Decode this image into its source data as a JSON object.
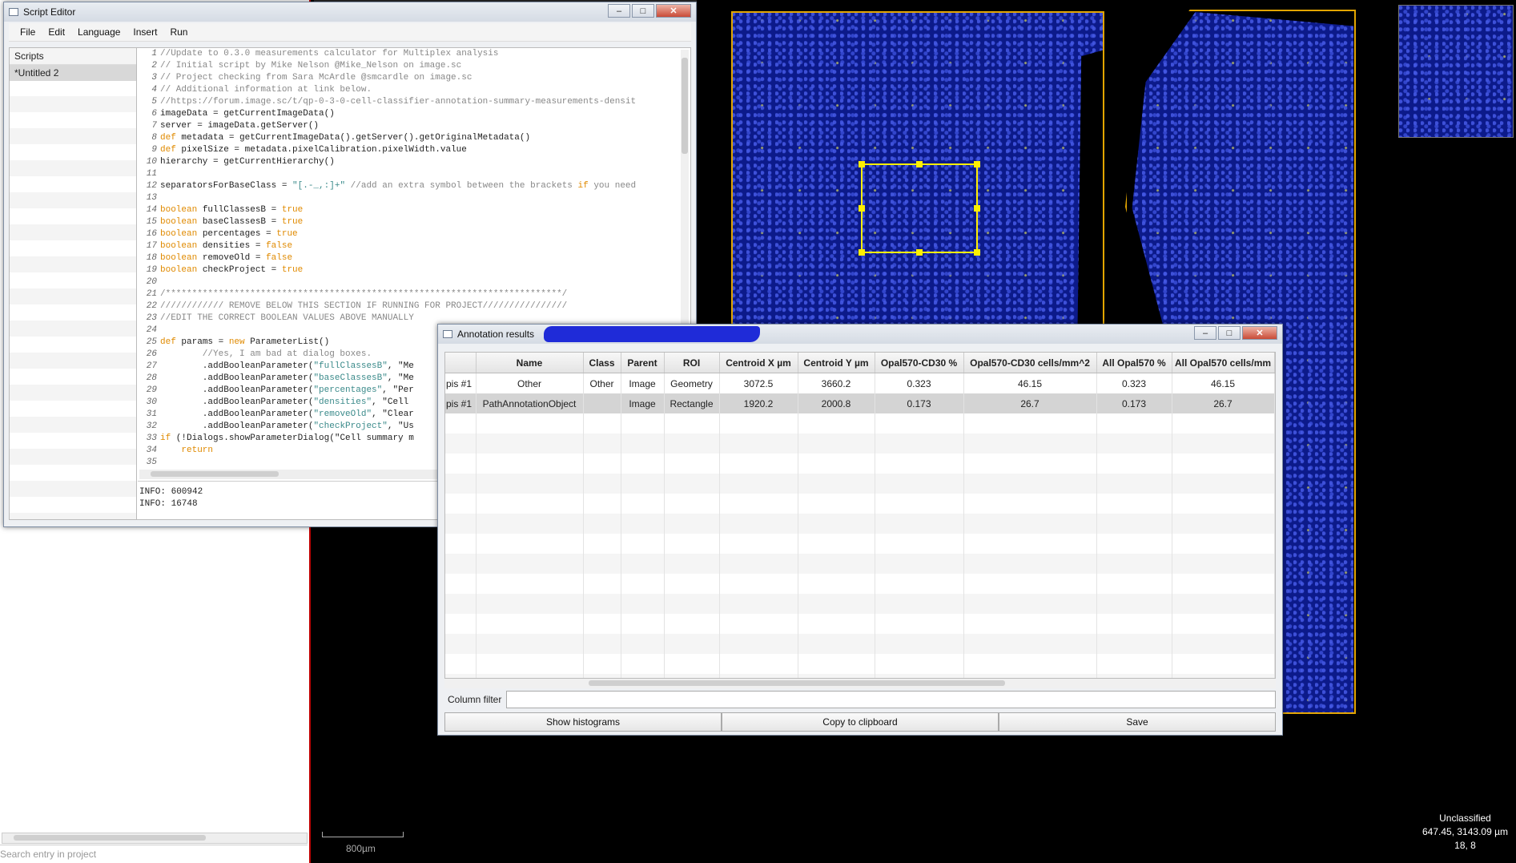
{
  "viewer": {
    "left_panel_search_placeholder": "Search entry in project",
    "scalebar_label": "800µm",
    "status": {
      "classification": "Unclassified",
      "coordinates": "647.45, 3143.09 µm",
      "pixel": "18, 8"
    }
  },
  "script_editor": {
    "title": "Script Editor",
    "menu": [
      "File",
      "Edit",
      "Language",
      "Insert",
      "Run"
    ],
    "scripts_header": "Scripts",
    "scripts": [
      "*Untitled 2"
    ],
    "code_lines": [
      "//Update to 0.3.0 measurements calculator for Multiplex analysis",
      "// Initial script by Mike Nelson @Mike_Nelson on image.sc",
      "// Project checking from Sara McArdle @smcardle on image.sc",
      "// Additional information at link below.",
      "//https://forum.image.sc/t/qp-0-3-0-cell-classifier-annotation-summary-measurements-densit",
      "imageData = getCurrentImageData()",
      "server = imageData.getServer()",
      "def metadata = getCurrentImageData().getServer().getOriginalMetadata()",
      "def pixelSize = metadata.pixelCalibration.pixelWidth.value",
      "hierarchy = getCurrentHierarchy()",
      "",
      "separatorsForBaseClass = \"[.-_,:]+\" //add an extra symbol between the brackets if you need",
      "",
      "boolean fullClassesB = true",
      "boolean baseClassesB = true",
      "boolean percentages = true",
      "boolean densities = false",
      "boolean removeOld = false",
      "boolean checkProject = true",
      "",
      "/***************************************************************************/",
      "//////////// REMOVE BELOW THIS SECTION IF RUNNING FOR PROJECT////////////////",
      "//EDIT THE CORRECT BOOLEAN VALUES ABOVE MANUALLY",
      "",
      "def params = new ParameterList()",
      "        //Yes, I am bad at dialog boxes.",
      "        .addBooleanParameter(\"fullClassesB\", \"Me",
      "        .addBooleanParameter(\"baseClassesB\", \"Me",
      "        .addBooleanParameter(\"percentages\", \"Per",
      "        .addBooleanParameter(\"densities\", \"Cell",
      "        .addBooleanParameter(\"removeOld\", \"Clear",
      "        .addBooleanParameter(\"checkProject\", \"Us",
      "if (!Dialogs.showParameterDialog(\"Cell summary m",
      "    return",
      ""
    ],
    "console": [
      "INFO: 600942",
      "INFO: 16748"
    ]
  },
  "annotation_results": {
    "title": "Annotation results",
    "columns": [
      "",
      "Name",
      "Class",
      "Parent",
      "ROI",
      "Centroid X µm",
      "Centroid Y µm",
      "Opal570-CD30 %",
      "Opal570-CD30 cells/mm^2",
      "All Opal570 %",
      "All Opal570 cells/mm"
    ],
    "rows": [
      [
        "pis #1",
        "Other",
        "Other",
        "Image",
        "Geometry",
        "3072.5",
        "3660.2",
        "0.323",
        "46.15",
        "0.323",
        "46.15"
      ],
      [
        "pis #1",
        "PathAnnotationObject",
        "",
        "Image",
        "Rectangle",
        "1920.2",
        "2000.8",
        "0.173",
        "26.7",
        "0.173",
        "26.7"
      ]
    ],
    "column_filter_label": "Column filter",
    "column_filter_value": "",
    "buttons": {
      "show_histograms": "Show histograms",
      "copy_to_clipboard": "Copy to clipboard",
      "save": "Save"
    }
  },
  "colors": {
    "annotation_outline": "#e2a500",
    "selected_annotation": "#ffef00",
    "tissue_stain": "#0c1a8a"
  }
}
